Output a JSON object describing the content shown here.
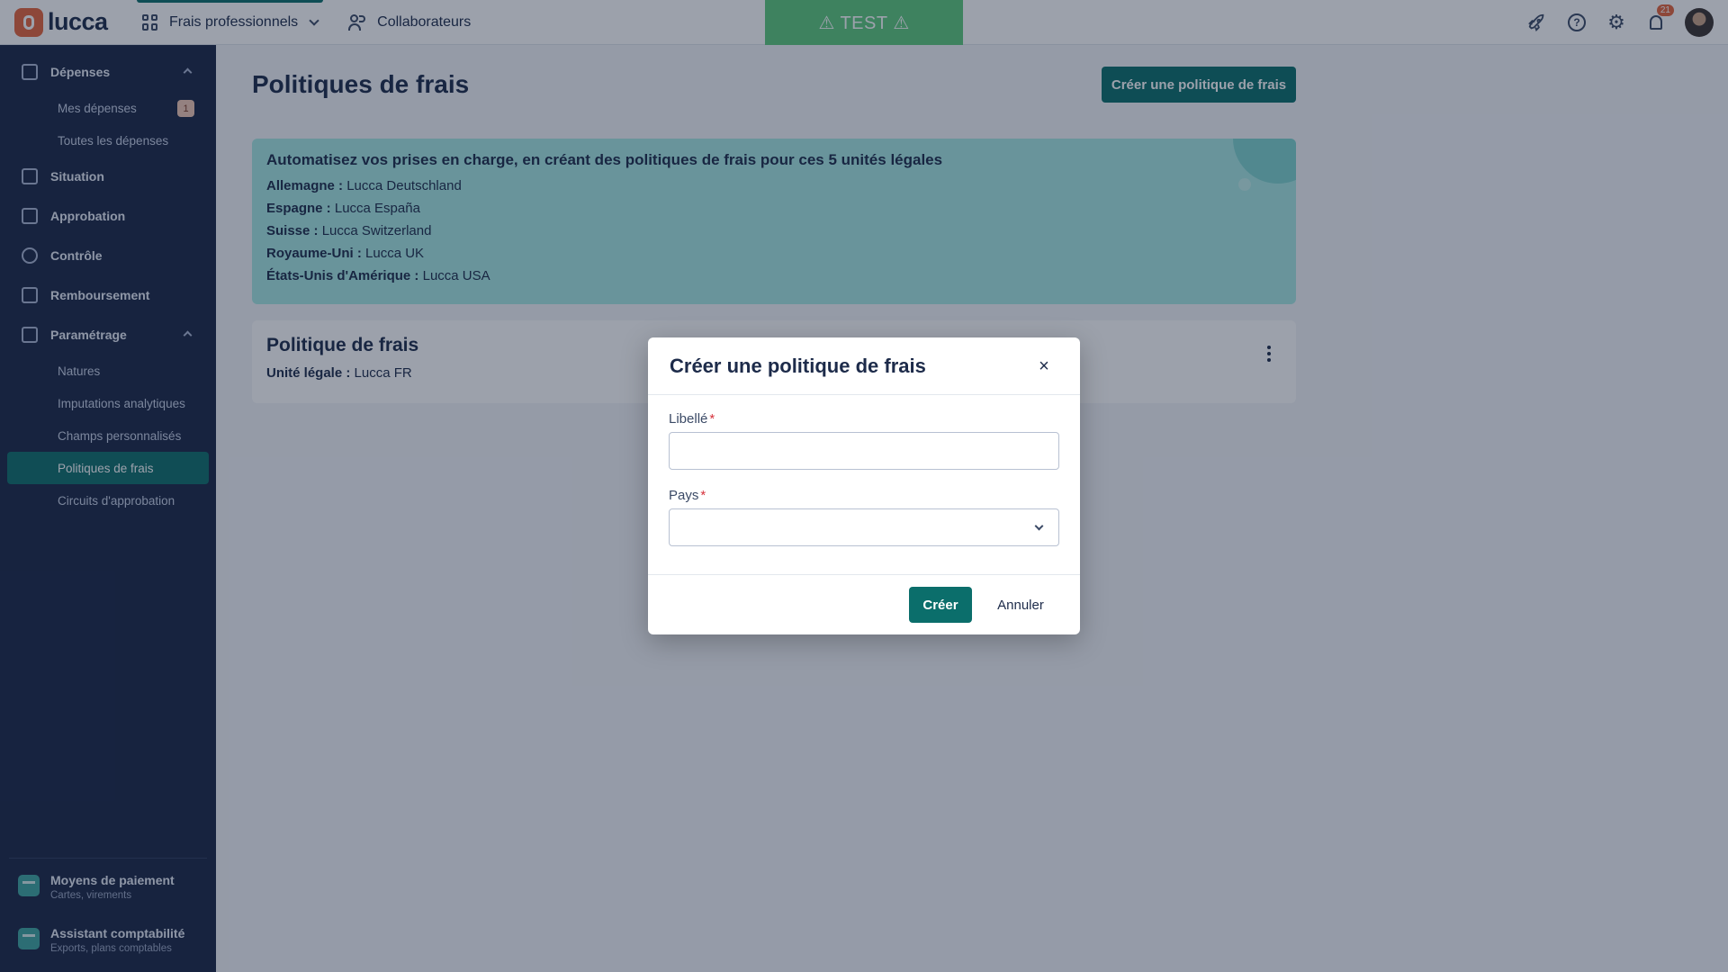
{
  "topbar": {
    "logo_text": "lucca",
    "app_switch_label": "Frais professionnels",
    "collaborators_label": "Collaborateurs",
    "env_banner": "⚠ TEST ⚠",
    "notification_count": "21",
    "icons": [
      "rocket-icon",
      "help-icon",
      "settings-icon",
      "bell-icon",
      "avatar"
    ]
  },
  "sidebar": {
    "sections": [
      {
        "label": "Dépenses",
        "icon": "wallet-icon",
        "expanded": true,
        "items": [
          {
            "label": "Mes dépenses",
            "badge": "1"
          },
          {
            "label": "Toutes les dépenses"
          }
        ]
      },
      {
        "label": "Situation",
        "icon": "situation-icon"
      },
      {
        "label": "Approbation",
        "icon": "approval-icon"
      },
      {
        "label": "Contrôle",
        "icon": "eye-icon"
      },
      {
        "label": "Remboursement",
        "icon": "reimbursement-icon"
      },
      {
        "label": "Paramétrage",
        "icon": "tools-icon",
        "expanded": true,
        "items": [
          {
            "label": "Natures"
          },
          {
            "label": "Imputations analytiques"
          },
          {
            "label": "Champs personnalisés"
          },
          {
            "label": "Politiques de frais",
            "active": true
          },
          {
            "label": "Circuits d'approbation"
          }
        ]
      }
    ],
    "footer": [
      {
        "title": "Moyens de paiement",
        "subtitle": "Cartes, virements"
      },
      {
        "title": "Assistant comptabilité",
        "subtitle": "Exports, plans comptables"
      }
    ]
  },
  "main": {
    "title": "Politiques de frais",
    "create_button": "Créer une politique de frais",
    "callout": {
      "title": "Automatisez vos prises en charge, en créant des politiques de frais pour ces 5 unités légales",
      "rows": [
        {
          "country": "Allemagne :",
          "entity": "Lucca Deutschland"
        },
        {
          "country": "Espagne :",
          "entity": "Lucca España"
        },
        {
          "country": "Suisse :",
          "entity": "Lucca Switzerland"
        },
        {
          "country": "Royaume-Uni :",
          "entity": "Lucca UK"
        },
        {
          "country": "États-Unis d'Amérique :",
          "entity": "Lucca USA"
        }
      ]
    },
    "policy_card": {
      "title": "Politique de frais",
      "unit_label": "Unité légale :",
      "unit_value": "Lucca FR"
    }
  },
  "dialog": {
    "title": "Créer une politique de frais",
    "close_glyph": "×",
    "fields": [
      {
        "label": "Libellé",
        "required_mark": "*",
        "value": "",
        "type": "text"
      },
      {
        "label": "Pays",
        "required_mark": "*",
        "value": "",
        "type": "select"
      }
    ],
    "submit_label": "Créer",
    "cancel_label": "Annuler"
  },
  "colors": {
    "primary": "#0b6e6b",
    "sidebar_bg": "#1a2746",
    "callout_bg": "#a7e8e3",
    "test_banner": "#5dca7d",
    "required": "#d6323c"
  }
}
